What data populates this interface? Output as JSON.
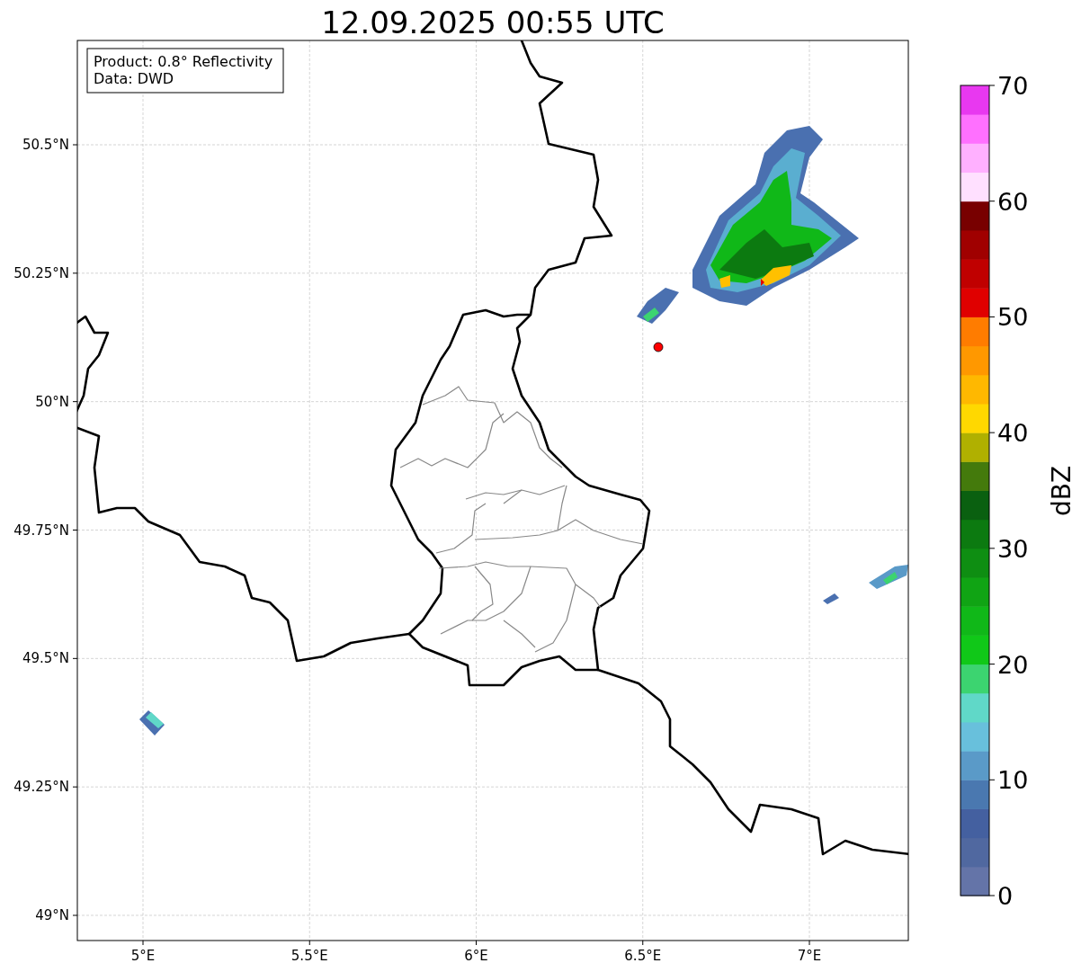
{
  "title": "12.09.2025 00:55 UTC",
  "map": {
    "info_lines": [
      "Product: 0.8° Reflectivity",
      "Data: DWD"
    ],
    "xticks": [
      "5°E",
      "5.5°E",
      "6°E",
      "6.5°E",
      "7°E"
    ],
    "yticks": [
      "50.5°N",
      "50.25°N",
      "50°N",
      "49.75°N",
      "49.5°N",
      "49.25°N",
      "49°N"
    ]
  },
  "colorbar": {
    "label": "dBZ",
    "ticks": [
      "70",
      "60",
      "50",
      "40",
      "30",
      "20",
      "10",
      "0"
    ],
    "levels": [
      {
        "color": "#6474a8"
      },
      {
        "color": "#5068a0"
      },
      {
        "color": "#4460a0"
      },
      {
        "color": "#4a78b0"
      },
      {
        "color": "#5a9ac8"
      },
      {
        "color": "#68c0dc"
      },
      {
        "color": "#60d8c8"
      },
      {
        "color": "#3cd470"
      },
      {
        "color": "#10c818"
      },
      {
        "color": "#10b818"
      },
      {
        "color": "#10a414"
      },
      {
        "color": "#0e8e12"
      },
      {
        "color": "#0c7a10"
      },
      {
        "color": "#0a6010"
      },
      {
        "color": "#447a0c"
      },
      {
        "color": "#b0b000"
      },
      {
        "color": "#ffd800"
      },
      {
        "color": "#ffb800"
      },
      {
        "color": "#ff9800"
      },
      {
        "color": "#ff7c00"
      },
      {
        "color": "#e00000"
      },
      {
        "color": "#c00000"
      },
      {
        "color": "#a00000"
      },
      {
        "color": "#780000"
      },
      {
        "color": "#ffe0ff"
      },
      {
        "color": "#ffb0ff"
      },
      {
        "color": "#ff70ff"
      },
      {
        "color": "#e838f0"
      }
    ]
  }
}
